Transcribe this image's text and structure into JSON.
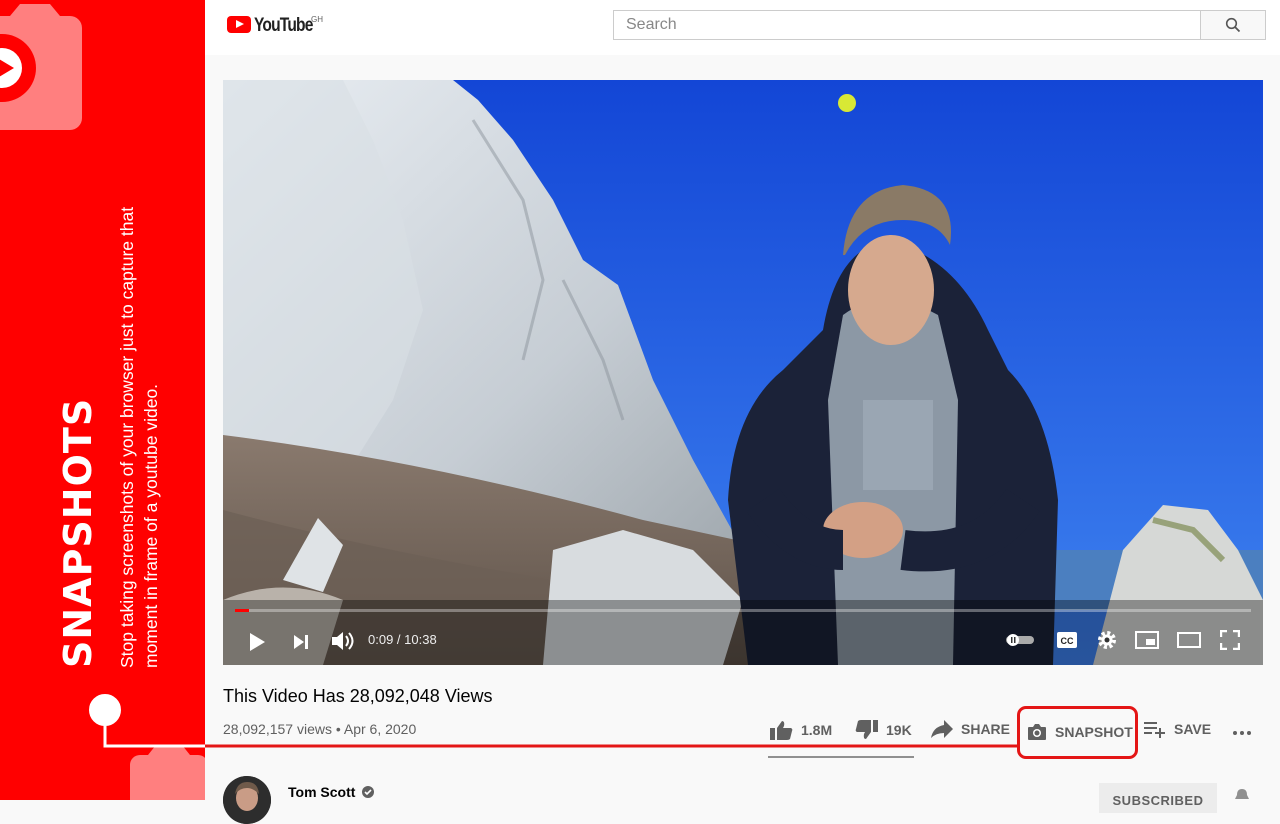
{
  "banner": {
    "title": "SNAPSHOTS",
    "description": "Stop taking screenshots of your browser just to capture that moment in frame of a youtube video."
  },
  "header": {
    "logo_text": "YouTube",
    "country_code": "GH",
    "search_placeholder": "Search"
  },
  "player": {
    "current_time": "0:09",
    "duration": "10:38",
    "time_display": "0:09 / 10:38",
    "progress_fraction": 0.014
  },
  "video": {
    "title": "This Video Has 28,092,048 Views",
    "meta": "28,092,157 views • Apr 6, 2020"
  },
  "actions": {
    "likes": "1.8M",
    "dislikes": "19K",
    "share": "SHARE",
    "snapshot": "SNAPSHOT",
    "save": "SAVE"
  },
  "channel": {
    "name": "Tom Scott",
    "subscribe_label": "SUBSCRIBED"
  },
  "colors": {
    "brand_red": "#ff0000",
    "highlight_red": "#e41616",
    "sky_blue": "#1c56d8"
  }
}
